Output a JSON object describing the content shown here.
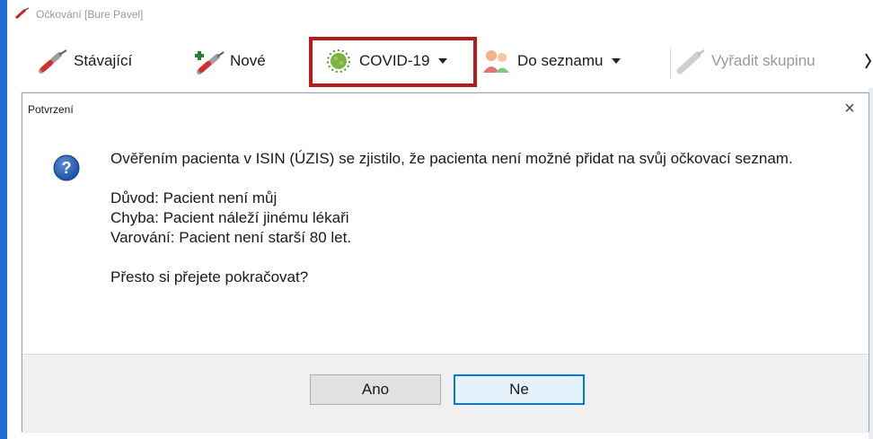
{
  "app": {
    "title": "Očkování [Bure Pavel]"
  },
  "toolbar": {
    "existing_label": "Stávající",
    "new_label": "Nové",
    "covid_label": "COVID-19",
    "to_list_label": "Do seznamu",
    "remove_group_label": "Vyřadit skupinu"
  },
  "dialog": {
    "title": "Potvrzení",
    "close_glyph": "×",
    "message_line1": "Ověřením pacienta v ISIN (ÚZIS) se zjistilo, že pacienta není možné přidat na svůj očkovací seznam.",
    "reason": "Důvod: Pacient není můj",
    "error": "Chyba: Pacient náleží jinému lékaři",
    "warning": "Varování: Pacient není starší 80 let.",
    "question": "Přesto si přejete pokračovat?",
    "yes_label": "Ano",
    "no_label": "Ne"
  },
  "colors": {
    "highlight_border": "#b71c1c",
    "default_button_border": "#0078d7",
    "window_border": "#1f6fd6"
  }
}
